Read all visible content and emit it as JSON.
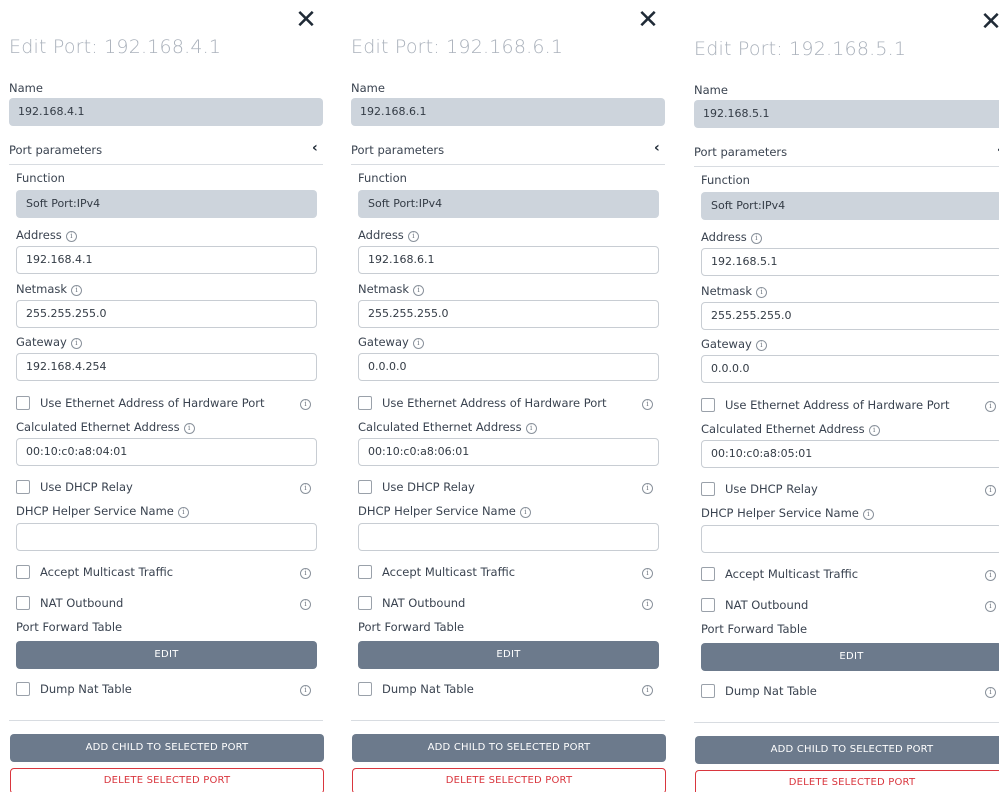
{
  "panels": [
    {
      "title": "Edit Port: 192.168.4.1",
      "name_label": "Name",
      "name_value": "192.168.4.1",
      "section_label": "Port parameters",
      "function_label": "Function",
      "function_value": "Soft Port:IPv4",
      "address_label": "Address",
      "address_value": "192.168.4.1",
      "netmask_label": "Netmask",
      "netmask_value": "255.255.255.0",
      "gateway_label": "Gateway",
      "gateway_value": "192.168.4.254",
      "use_eth_label": "Use Ethernet Address of Hardware Port",
      "calc_eth_label": "Calculated Ethernet Address",
      "calc_eth_value": "00:10:c0:a8:04:01",
      "use_dhcp_label": "Use DHCP Relay",
      "dhcp_helper_label": "DHCP Helper Service Name",
      "dhcp_helper_value": "",
      "multicast_label": "Accept Multicast Traffic",
      "nat_label": "NAT Outbound",
      "pft_label": "Port Forward Table",
      "edit_label": "EDIT",
      "dump_label": "Dump Nat Table",
      "add_child_label": "ADD CHILD TO SELECTED PORT",
      "delete_label": "DELETE SELECTED PORT",
      "close_icon": "close-icon",
      "collapse_icon": "chevron-left-icon",
      "info_icon": "info-icon"
    },
    {
      "title": "Edit Port: 192.168.6.1",
      "name_label": "Name",
      "name_value": "192.168.6.1",
      "section_label": "Port parameters",
      "function_label": "Function",
      "function_value": "Soft Port:IPv4",
      "address_label": "Address",
      "address_value": "192.168.6.1",
      "netmask_label": "Netmask",
      "netmask_value": "255.255.255.0",
      "gateway_label": "Gateway",
      "gateway_value": "0.0.0.0",
      "use_eth_label": "Use Ethernet Address of Hardware Port",
      "calc_eth_label": "Calculated Ethernet Address",
      "calc_eth_value": "00:10:c0:a8:06:01",
      "use_dhcp_label": "Use DHCP Relay",
      "dhcp_helper_label": "DHCP Helper Service Name",
      "dhcp_helper_value": "",
      "multicast_label": "Accept Multicast Traffic",
      "nat_label": "NAT Outbound",
      "pft_label": "Port Forward Table",
      "edit_label": "EDIT",
      "dump_label": "Dump Nat Table",
      "add_child_label": "ADD CHILD TO SELECTED PORT",
      "delete_label": "DELETE SELECTED PORT",
      "close_icon": "close-icon",
      "collapse_icon": "chevron-left-icon",
      "info_icon": "info-icon"
    },
    {
      "title": "Edit Port: 192.168.5.1",
      "name_label": "Name",
      "name_value": "192.168.5.1",
      "section_label": "Port parameters",
      "function_label": "Function",
      "function_value": "Soft Port:IPv4",
      "address_label": "Address",
      "address_value": "192.168.5.1",
      "netmask_label": "Netmask",
      "netmask_value": "255.255.255.0",
      "gateway_label": "Gateway",
      "gateway_value": "0.0.0.0",
      "use_eth_label": "Use Ethernet Address of Hardware Port",
      "calc_eth_label": "Calculated Ethernet Address",
      "calc_eth_value": "00:10:c0:a8:05:01",
      "use_dhcp_label": "Use DHCP Relay",
      "dhcp_helper_label": "DHCP Helper Service Name",
      "dhcp_helper_value": "",
      "multicast_label": "Accept Multicast Traffic",
      "nat_label": "NAT Outbound",
      "pft_label": "Port Forward Table",
      "edit_label": "EDIT",
      "dump_label": "Dump Nat Table",
      "add_child_label": "ADD CHILD TO SELECTED PORT",
      "delete_label": "DELETE SELECTED PORT",
      "close_icon": "close-icon",
      "collapse_icon": "chevron-left-icon",
      "info_icon": "info-icon"
    }
  ],
  "colors": {
    "button_bg": "#6c7a8c",
    "delete_red": "#d9363e",
    "disabled_field": "#cdd4dc",
    "title_gray": "#aab1bb"
  }
}
